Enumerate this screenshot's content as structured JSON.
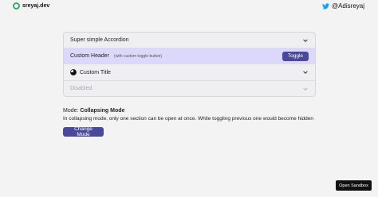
{
  "header": {
    "brand": "sreyaj.dev",
    "twitter_handle": "@Adisreyaj"
  },
  "accordion": {
    "items": [
      {
        "title": "Super simple Accordion"
      },
      {
        "title": "Custom Header",
        "subtitle": "(with custom toggle button)",
        "toggle_label": "Toggle"
      },
      {
        "title": "Custom Title"
      },
      {
        "title": "Disabled"
      }
    ]
  },
  "mode": {
    "label": "Mode: ",
    "value": "Collapsing Mode",
    "description": "In collapsing mode, only one section can be open at once. While toggling previous one would become hidden",
    "change_button": "Change Mode"
  },
  "sandbox_button": "Open Sandbox",
  "colors": {
    "accent": "#4a4899",
    "highlight_row": "#dcd8fb",
    "background": "#f3f3f4"
  }
}
